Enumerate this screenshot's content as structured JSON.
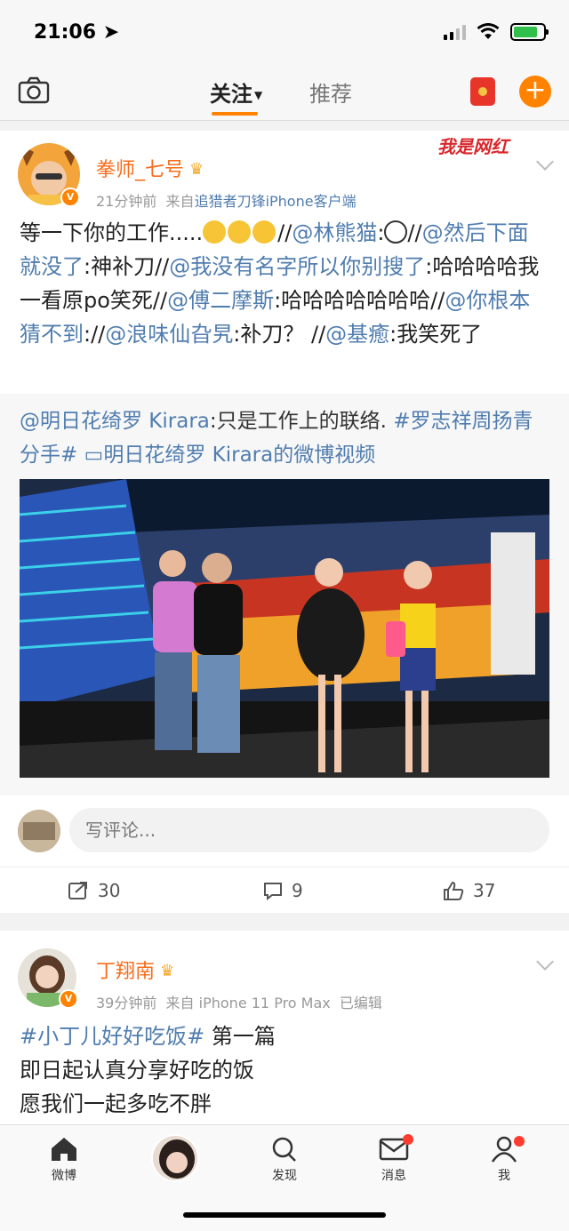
{
  "status_bar": {
    "time": "21:06"
  },
  "nav": {
    "tab_follow": "关注",
    "tab_recommend": "推荐"
  },
  "post1": {
    "username": "拳师_七号",
    "time": "21分钟前",
    "source_prefix": "来自",
    "source": "追猎者刀锋iPhone客户端",
    "watermark": "我是网红",
    "segments": [
      {
        "text": "等一下你的工作.....",
        "link": false
      },
      {
        "text": "//",
        "link": false
      },
      {
        "text": "@林熊猫",
        "link": true
      },
      {
        "text": ":",
        "link": false
      },
      {
        "text": "//",
        "link": false
      },
      {
        "text": "@然后下面就没了",
        "link": true
      },
      {
        "text": ":神补刀//",
        "link": false
      },
      {
        "text": "@我没有名字所以你别搜了",
        "link": true
      },
      {
        "text": ":哈哈哈哈我一看原po笑死//",
        "link": false
      },
      {
        "text": "@傅二摩斯",
        "link": true
      },
      {
        "text": ":哈哈哈哈哈哈哈//",
        "link": false
      },
      {
        "text": "@你根本猜不到",
        "link": true
      },
      {
        "text": "://",
        "link": false
      },
      {
        "text": "@浪味仙旮旯",
        "link": true
      },
      {
        "text": ":补刀？ //",
        "link": false
      },
      {
        "text": "@基癒",
        "link": true
      },
      {
        "text": ":我笑死了",
        "link": false
      }
    ],
    "repost": {
      "author": "@明日花绮罗 Kirara",
      "text": ":只是工作上的联络. ",
      "hashtag": "#罗志祥周扬青分手#",
      "video_label": "明日花绮罗 Kirara的微博视频"
    },
    "comment_placeholder": "写评论...",
    "reposts": "30",
    "comments": "9",
    "likes": "37"
  },
  "post2": {
    "username": "丁翔南",
    "time": "39分钟前",
    "source_prefix": "来自",
    "source": "iPhone 11 Pro Max",
    "edited": "已编辑",
    "hashtag": "#小丁儿好好吃饭#",
    "line1_rest": " 第一篇",
    "line2": "即日起认真分享好吃的饭",
    "line3": "愿我们一起多吃不胖"
  },
  "tabbar": {
    "home": "微博",
    "discover": "发现",
    "messages": "消息",
    "me": "我"
  },
  "colors": {
    "accent": "#ff8200",
    "link": "#507daf",
    "username": "#f86c1b"
  }
}
